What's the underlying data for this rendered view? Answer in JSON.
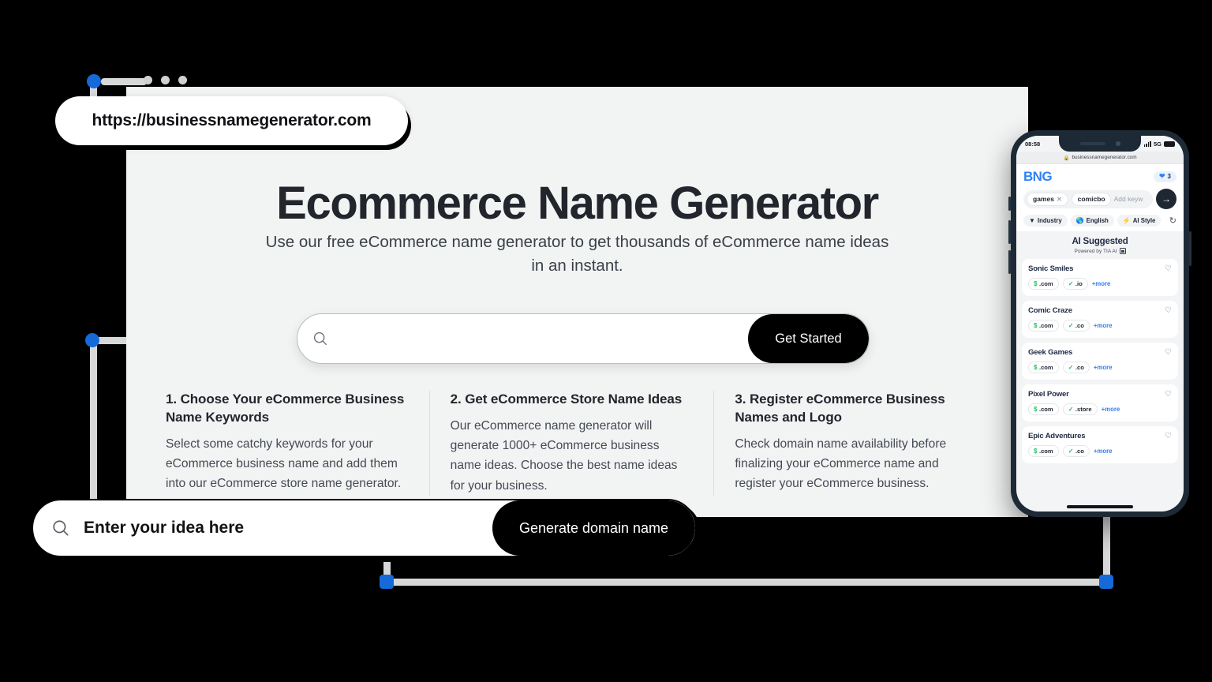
{
  "browser": {
    "url": "https://businessnamegenerator.com",
    "traffic_dots": 3
  },
  "hero": {
    "title": "Ecommerce Name Generator",
    "subtitle": "Use our free eCommerce name generator to get thousands of eCommerce name ideas in an instant.",
    "search_placeholder": "",
    "search_value": "",
    "cta_label": "Get Started",
    "search_icon": "search-icon"
  },
  "steps": [
    {
      "heading": "1. Choose Your eCommerce Business Name Keywords",
      "body": "Select some catchy keywords for your eCommerce business name and add them into our eCommerce store name generator."
    },
    {
      "heading": "2. Get eCommerce Store Name Ideas",
      "body": "Our eCommerce name generator will generate 1000+ eCommerce business name ideas. Choose the best name ideas for your business."
    },
    {
      "heading": "3. Register eCommerce Business Names and Logo",
      "body": "Check domain name availability before finalizing your eCommerce name and register your eCommerce business."
    }
  ],
  "idea_bar": {
    "placeholder": "Enter your idea here",
    "value": "",
    "cta_label": "Generate domain name",
    "search_icon": "search-icon"
  },
  "phone": {
    "status": {
      "time": "08:58",
      "network": "5G",
      "signal_icon": "signal-bars-icon",
      "battery_icon": "battery-icon"
    },
    "address_bar": {
      "lock_icon": "lock-icon",
      "url": "businessnamegenerator.com"
    },
    "app": {
      "brand": "BNG",
      "brand_color": "#2f82f5",
      "favorites_count": "3",
      "favorites_icon": "heart-filled-icon",
      "keywords": [
        {
          "label": "games",
          "remove_icon": "close-icon"
        },
        {
          "label": "comicbo",
          "remove_icon": "close-icon"
        }
      ],
      "keyword_placeholder": "Add keyw",
      "go_icon": "arrow-right-icon",
      "filters": [
        {
          "label": "Industry",
          "icon": "filter-icon",
          "glyph": "☰"
        },
        {
          "label": "English",
          "icon": "globe-icon",
          "glyph": "⊕"
        },
        {
          "label": "AI Style",
          "icon": "bolt-icon",
          "glyph": "⚡"
        }
      ],
      "refresh_icon": "refresh-icon",
      "section_title": "AI Suggested",
      "section_subtitle": "Powered by TIA AI",
      "section_sub_icon": "chip-icon",
      "results": [
        {
          "name": "Sonic Smiles",
          "heart_icon": "heart-outline-icon",
          "tags": [
            {
              "glyph": "$",
              "label": ".com"
            },
            {
              "glyph": "✓",
              "label": ".io"
            }
          ],
          "more": "+more"
        },
        {
          "name": "Comic Craze",
          "heart_icon": "heart-outline-icon",
          "tags": [
            {
              "glyph": "$",
              "label": ".com"
            },
            {
              "glyph": "✓",
              "label": ".co"
            }
          ],
          "more": "+more"
        },
        {
          "name": "Geek Games",
          "heart_icon": "heart-outline-icon",
          "tags": [
            {
              "glyph": "$",
              "label": ".com"
            },
            {
              "glyph": "✓",
              "label": ".co"
            }
          ],
          "more": "+more"
        },
        {
          "name": "Pixel Power",
          "heart_icon": "heart-outline-icon",
          "tags": [
            {
              "glyph": "$",
              "label": ".com"
            },
            {
              "glyph": "✓",
              "label": ".store"
            }
          ],
          "more": "+more"
        },
        {
          "name": "Epic Adventures",
          "heart_icon": "heart-outline-icon",
          "tags": [
            {
              "glyph": "$",
              "label": ".com"
            },
            {
              "glyph": "✓",
              "label": ".co"
            }
          ],
          "more": "+more"
        }
      ]
    }
  },
  "colors": {
    "accent_blue": "#1669d8",
    "brand_blue": "#2f82f5",
    "available_green": "#21c55d",
    "dark": "#000000",
    "canvas": "#f2f3f3"
  }
}
